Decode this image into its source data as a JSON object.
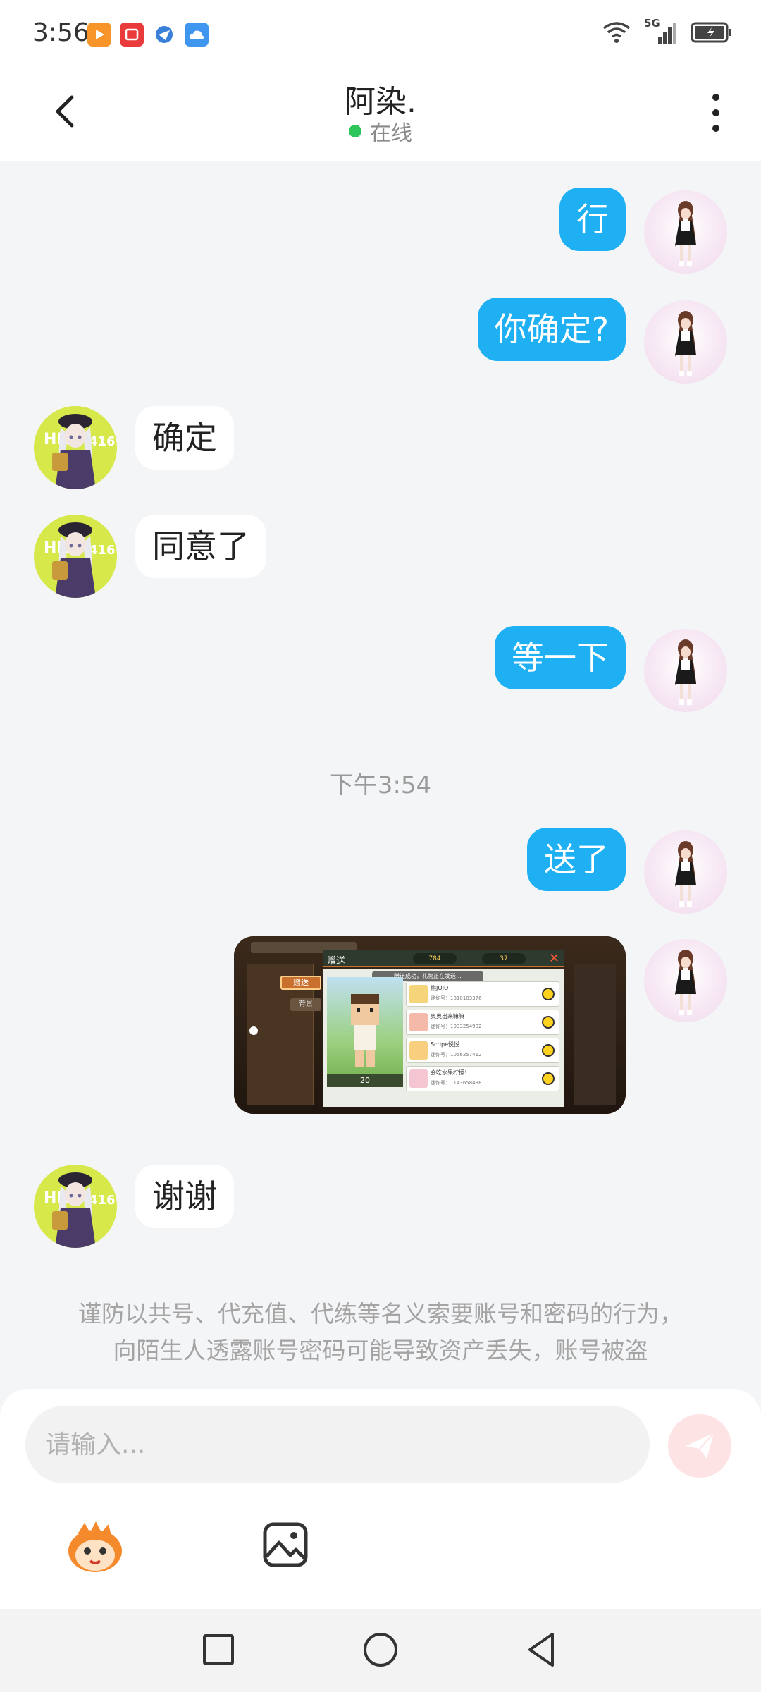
{
  "status_bar": {
    "time": "3:56",
    "network": "5G",
    "app_icons": [
      "app-orange-icon",
      "app-red-icon",
      "app-blue-globe-icon",
      "app-cloud-icon"
    ]
  },
  "header": {
    "contact_name": "阿染.",
    "status": "在线",
    "status_color": "#2ec65a"
  },
  "messages": [
    {
      "from": "me",
      "text": "行"
    },
    {
      "from": "me",
      "text": "你确定?"
    },
    {
      "from": "them",
      "text": "确定"
    },
    {
      "from": "them",
      "text": "同意了"
    },
    {
      "from": "me",
      "text": "等一下"
    },
    {
      "type": "time",
      "text": "下午3:54"
    },
    {
      "from": "me",
      "text": "送了"
    },
    {
      "from": "me",
      "type": "image",
      "image_texts": {
        "title": "赠送",
        "tab_gift": "赠送",
        "tab_list": "背景",
        "coins_1": "784",
        "coins_2": "37",
        "notice": "赠送成功，礼物正在发送…",
        "count": "20",
        "friends": [
          {
            "name": "熊JOJO",
            "id": "迷你号：1810183376"
          },
          {
            "name": "奥奥出来嘛嘛",
            "id": "迷你号：1033254982"
          },
          {
            "name": "Scripe悦悦",
            "id": "迷你号：1056257412"
          },
          {
            "name": "会吃水果柠檬！",
            "id": "迷你号：1143658488"
          }
        ]
      }
    },
    {
      "from": "them",
      "text": "谢谢"
    }
  ],
  "warning": {
    "line1": "谨防以共号、代充值、代练等名义索要账号和密码的行为，",
    "line2": "向陌生人透露账号密码可能导致资产丢失，账号被盗"
  },
  "input": {
    "placeholder": "请输入..."
  },
  "colors": {
    "my_bubble": "#1fb0f4",
    "their_bubble": "#ffffff",
    "send_button": "#fde3e3"
  }
}
